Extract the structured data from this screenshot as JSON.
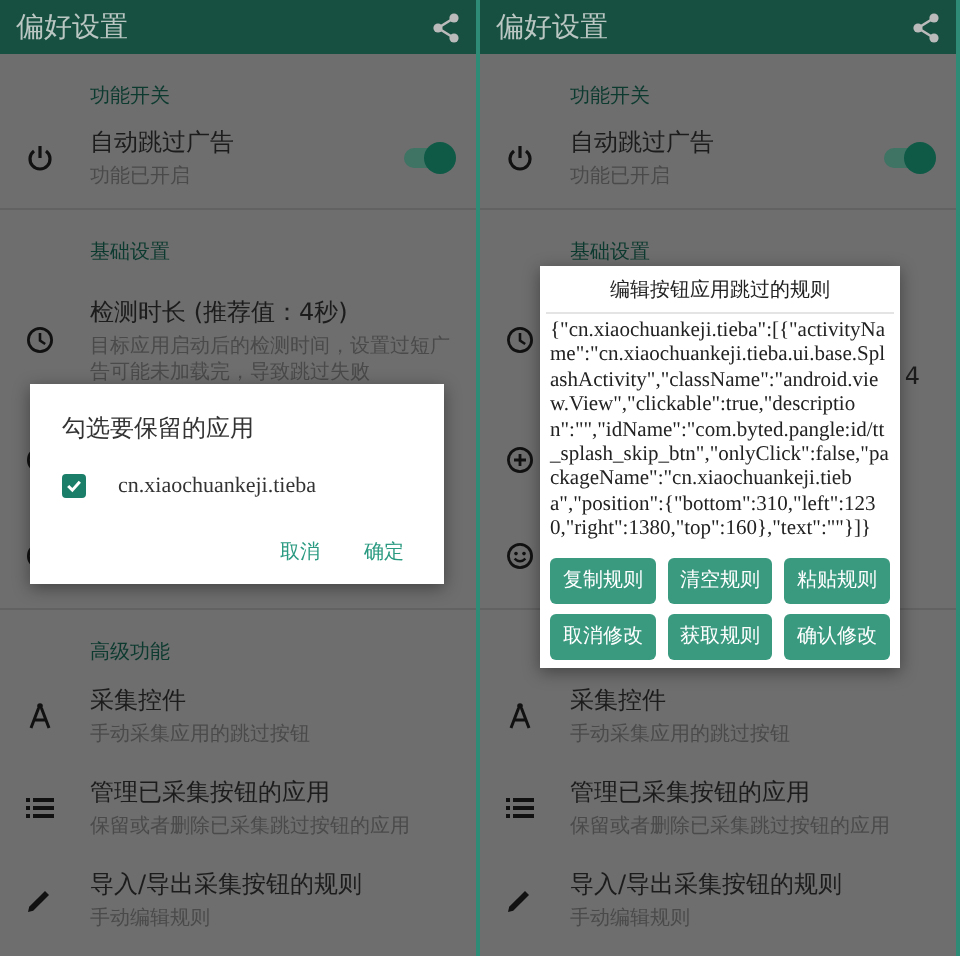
{
  "screens": [
    {
      "app_bar": {
        "title": "偏好设置"
      },
      "sections": [
        {
          "header": "功能开关",
          "items": [
            {
              "kind": "toggle",
              "title": "自动跳过广告",
              "subtitle": "功能已开启",
              "on": true
            }
          ]
        },
        {
          "header": "基础设置",
          "items": [
            {
              "kind": "duration",
              "title": "检测时长 (推荐值：4秒)",
              "subtitle": "目标应用启动后的检测时间，设置过短广告可能未加载完，导致跳过失败"
            },
            {
              "kind": "add"
            },
            {
              "kind": "emoji"
            }
          ]
        },
        {
          "header": "高级功能",
          "items": [
            {
              "kind": "collect",
              "title": "采集控件",
              "subtitle": "手动采集应用的跳过按钮"
            },
            {
              "kind": "manage",
              "title": "管理已采集按钮的应用",
              "subtitle": "保留或者删除已采集跳过按钮的应用"
            },
            {
              "kind": "edit",
              "title": "导入/导出采集按钮的规则",
              "subtitle": "手动编辑规则"
            }
          ]
        }
      ],
      "dialog": {
        "kind": "choice",
        "title": "勾选要保留的应用",
        "options": [
          {
            "label": "cn.xiaochuankeji.tieba",
            "checked": true
          }
        ],
        "buttons": [
          "取消",
          "确定"
        ]
      }
    },
    {
      "app_bar": {
        "title": "偏好设置"
      },
      "sections": [
        {
          "header": "功能开关",
          "items": [
            {
              "kind": "toggle",
              "title": "自动跳过广告",
              "subtitle": "功能已开启",
              "on": true
            }
          ]
        },
        {
          "header": "基础设置",
          "items": [
            {
              "kind": "duration",
              "value": "4"
            },
            {
              "kind": "add"
            },
            {
              "kind": "emoji"
            }
          ]
        },
        {
          "items": [
            {
              "kind": "collect",
              "title": "采集控件",
              "subtitle": "手动采集应用的跳过按钮"
            },
            {
              "kind": "manage",
              "title": "管理已采集按钮的应用",
              "subtitle": "保留或者删除已采集跳过按钮的应用"
            },
            {
              "kind": "edit",
              "title": "导入/导出采集按钮的规则",
              "subtitle": "手动编辑规则"
            }
          ]
        }
      ],
      "dialog": {
        "kind": "editor",
        "title": "编辑按钮应用跳过的规则",
        "text": "{\"cn.xiaochuankeji.tieba\":[{\"activityName\":\"cn.xiaochuankeji.tieba.ui.base.SplashActivity\",\"className\":\"android.view.View\",\"clickable\":true,\"description\":\"\",\"idName\":\"com.byted.pangle:id/tt_splash_skip_btn\",\"onlyClick\":false,\"packageName\":\"cn.xiaochuankeji.tieba\",\"position\":{\"bottom\":310,\"left\":1230,\"right\":1380,\"top\":160},\"text\":\"\"}]}",
        "buttons": [
          "复制规则",
          "清空规则",
          "粘贴规则",
          "取消修改",
          "获取规则",
          "确认修改"
        ]
      }
    }
  ]
}
